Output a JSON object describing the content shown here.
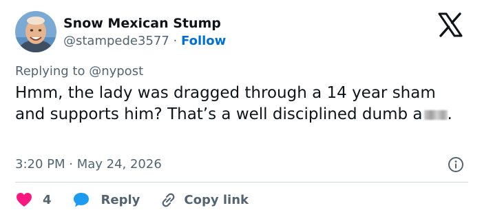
{
  "user": {
    "display_name": "Snow Mexican Stump",
    "handle": "@stampede3577",
    "separator": "·",
    "follow_label": "Follow"
  },
  "tweet": {
    "replying_to": "Replying to @nypost",
    "text": "Hmm, the lady was dragged through a 14 year sham and supports him? That’s a well disciplined dumb a",
    "text_end": ".",
    "timestamp": "3:20 PM · May 24, 2026"
  },
  "actions": {
    "like_count": "4",
    "reply_label": "Reply",
    "copy_link_label": "Copy link"
  },
  "colors": {
    "like": "#f91880",
    "reply": "#1d9bf0",
    "follow": "#006fd6",
    "muted": "#536471"
  },
  "icons": [
    "x-logo-icon",
    "info-icon",
    "heart-icon",
    "speech-bubble-icon",
    "link-icon"
  ]
}
